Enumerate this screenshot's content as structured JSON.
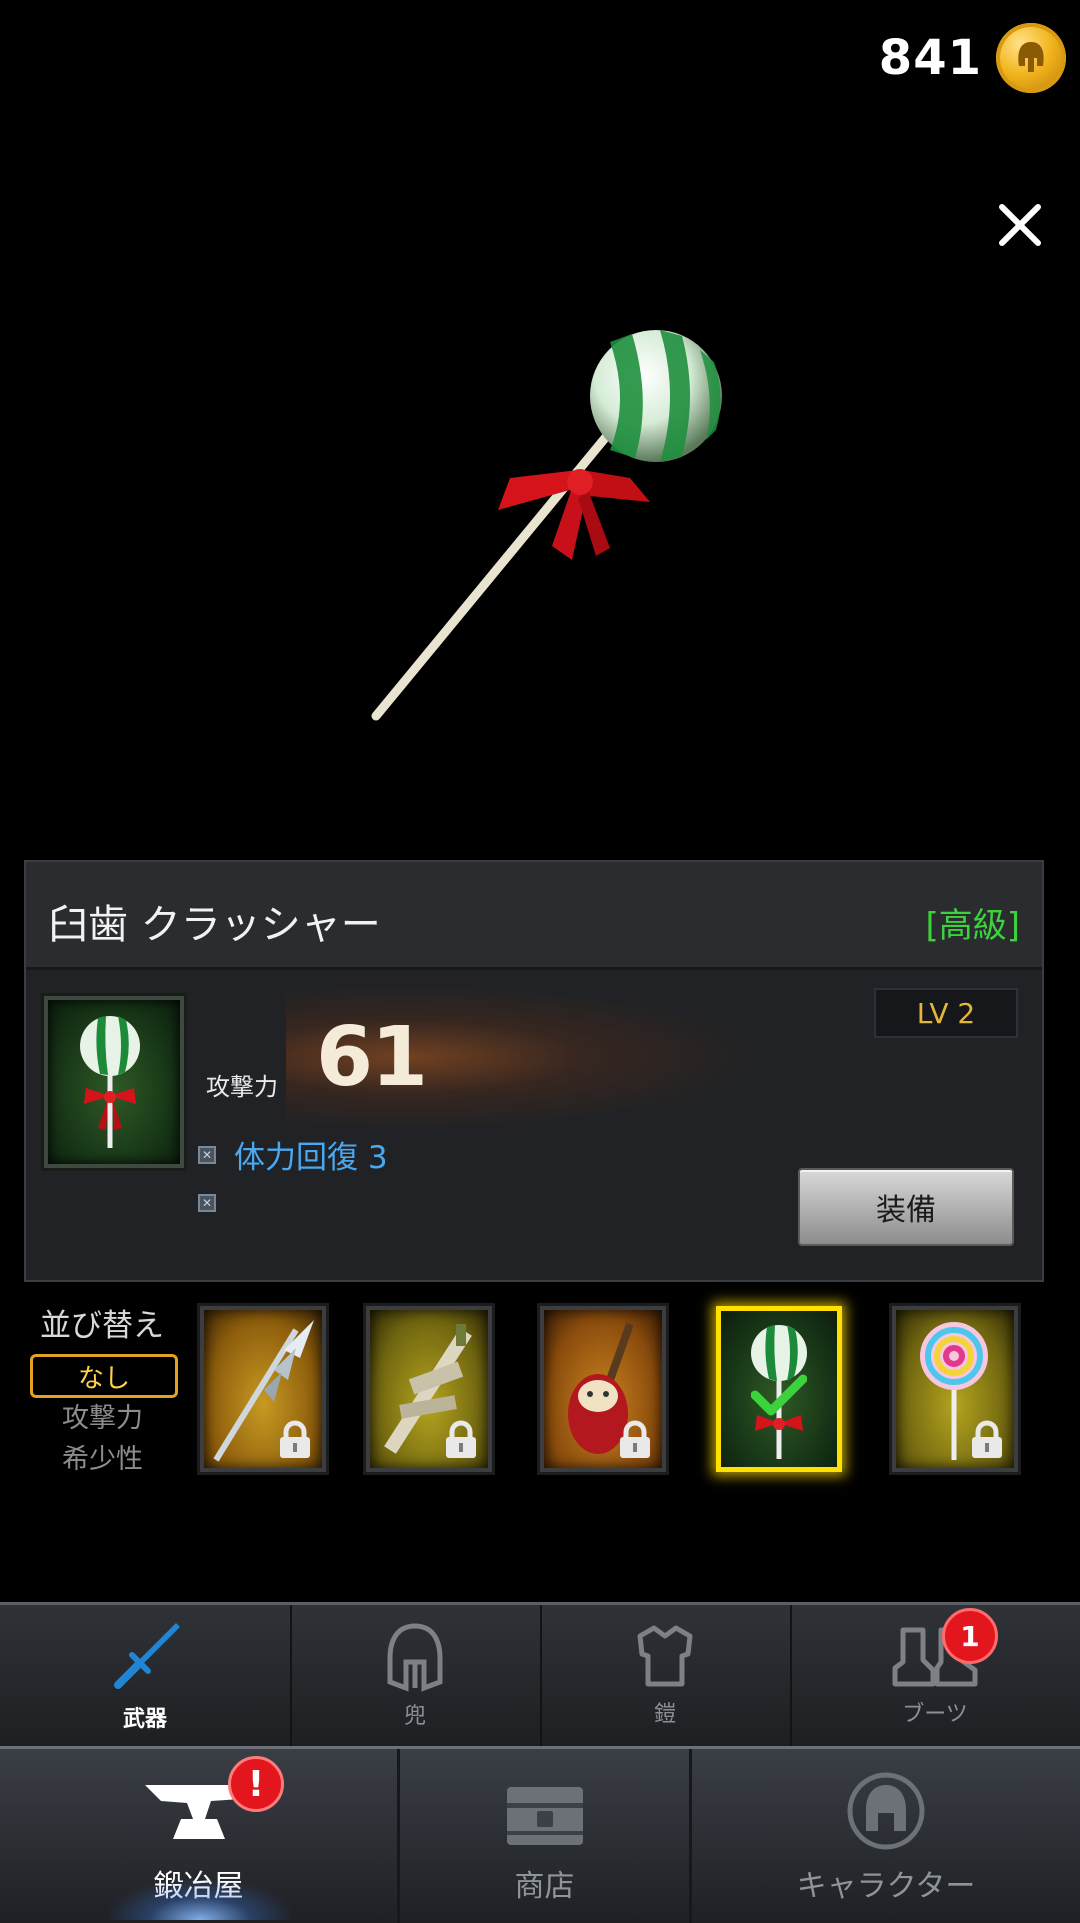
{
  "currency": {
    "amount": "841",
    "icon": "coin-helmet-icon"
  },
  "close": {
    "icon": "close-icon"
  },
  "item": {
    "name": "臼歯 クラッシャー",
    "rarity": "[高級]",
    "level": "LV 2",
    "attack_label": "攻撃力",
    "attack_value": "61",
    "skills": [
      "体力回復 3"
    ],
    "equip_label": "装備",
    "rarity_color": "#3cd23c"
  },
  "sort": {
    "title": "並び替え",
    "selected": "なし",
    "options": [
      "攻撃力",
      "希少性"
    ]
  },
  "inventory": [
    {
      "name": "silver-spear",
      "locked": true,
      "selected": false
    },
    {
      "name": "bone-sword",
      "locked": true,
      "selected": false
    },
    {
      "name": "meat-club",
      "locked": true,
      "selected": false
    },
    {
      "name": "green-lollipop",
      "locked": false,
      "selected": true
    },
    {
      "name": "rainbow-lollipop",
      "locked": true,
      "selected": false
    }
  ],
  "categories": [
    {
      "label": "武器",
      "icon": "sword-icon",
      "active": true
    },
    {
      "label": "兜",
      "icon": "helmet-icon",
      "active": false
    },
    {
      "label": "鎧",
      "icon": "armor-icon",
      "active": false
    },
    {
      "label": "ブーツ",
      "icon": "boots-icon",
      "active": false,
      "badge": "1"
    }
  ],
  "nav": [
    {
      "label": "鍛冶屋",
      "icon": "anvil-icon",
      "active": true,
      "badge": "!"
    },
    {
      "label": "商店",
      "icon": "chest-icon",
      "active": false
    },
    {
      "label": "キャラクター",
      "icon": "spartan-helmet-icon",
      "active": false
    }
  ],
  "colors": {
    "accent_gold": "#ffe000",
    "badge_red": "#e3161d",
    "skill_blue": "#4aa8f0"
  }
}
